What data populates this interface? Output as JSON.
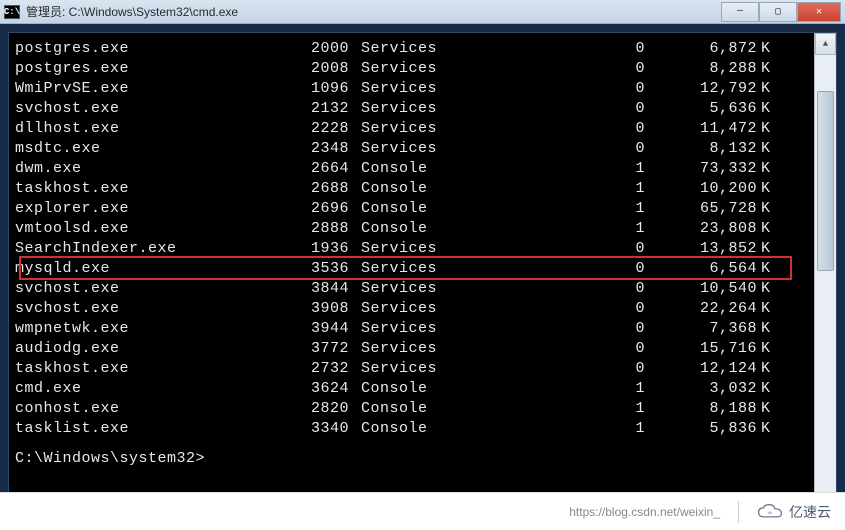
{
  "window": {
    "title": "管理员: C:\\Windows\\System32\\cmd.exe",
    "controls": {
      "min": "—",
      "max": "▢",
      "close": "✕"
    }
  },
  "processes": [
    {
      "name": "postgres.exe",
      "pid": "2000",
      "session": "Services",
      "sess_no": "0",
      "mem": "6,872",
      "unit": "K"
    },
    {
      "name": "postgres.exe",
      "pid": "2008",
      "session": "Services",
      "sess_no": "0",
      "mem": "8,288",
      "unit": "K"
    },
    {
      "name": "WmiPrvSE.exe",
      "pid": "1096",
      "session": "Services",
      "sess_no": "0",
      "mem": "12,792",
      "unit": "K"
    },
    {
      "name": "svchost.exe",
      "pid": "2132",
      "session": "Services",
      "sess_no": "0",
      "mem": "5,636",
      "unit": "K"
    },
    {
      "name": "dllhost.exe",
      "pid": "2228",
      "session": "Services",
      "sess_no": "0",
      "mem": "11,472",
      "unit": "K"
    },
    {
      "name": "msdtc.exe",
      "pid": "2348",
      "session": "Services",
      "sess_no": "0",
      "mem": "8,132",
      "unit": "K"
    },
    {
      "name": "dwm.exe",
      "pid": "2664",
      "session": "Console",
      "sess_no": "1",
      "mem": "73,332",
      "unit": "K"
    },
    {
      "name": "taskhost.exe",
      "pid": "2688",
      "session": "Console",
      "sess_no": "1",
      "mem": "10,200",
      "unit": "K"
    },
    {
      "name": "explorer.exe",
      "pid": "2696",
      "session": "Console",
      "sess_no": "1",
      "mem": "65,728",
      "unit": "K"
    },
    {
      "name": "vmtoolsd.exe",
      "pid": "2888",
      "session": "Console",
      "sess_no": "1",
      "mem": "23,808",
      "unit": "K"
    },
    {
      "name": "SearchIndexer.exe",
      "pid": "1936",
      "session": "Services",
      "sess_no": "0",
      "mem": "13,852",
      "unit": "K"
    },
    {
      "name": "mysqld.exe",
      "pid": "3536",
      "session": "Services",
      "sess_no": "0",
      "mem": "6,564",
      "unit": "K"
    },
    {
      "name": "svchost.exe",
      "pid": "3844",
      "session": "Services",
      "sess_no": "0",
      "mem": "10,540",
      "unit": "K"
    },
    {
      "name": "svchost.exe",
      "pid": "3908",
      "session": "Services",
      "sess_no": "0",
      "mem": "22,264",
      "unit": "K"
    },
    {
      "name": "wmpnetwk.exe",
      "pid": "3944",
      "session": "Services",
      "sess_no": "0",
      "mem": "7,368",
      "unit": "K"
    },
    {
      "name": "audiodg.exe",
      "pid": "3772",
      "session": "Services",
      "sess_no": "0",
      "mem": "15,716",
      "unit": "K"
    },
    {
      "name": "taskhost.exe",
      "pid": "2732",
      "session": "Services",
      "sess_no": "0",
      "mem": "12,124",
      "unit": "K"
    },
    {
      "name": "cmd.exe",
      "pid": "3624",
      "session": "Console",
      "sess_no": "1",
      "mem": "3,032",
      "unit": "K"
    },
    {
      "name": "conhost.exe",
      "pid": "2820",
      "session": "Console",
      "sess_no": "1",
      "mem": "8,188",
      "unit": "K"
    },
    {
      "name": "tasklist.exe",
      "pid": "3340",
      "session": "Console",
      "sess_no": "1",
      "mem": "5,836",
      "unit": "K"
    }
  ],
  "prompt": "C:\\Windows\\system32>",
  "highlighted_index": 11,
  "footer": {
    "watermark": "https://blog.csdn.net/weixin_",
    "brand": "亿速云"
  }
}
